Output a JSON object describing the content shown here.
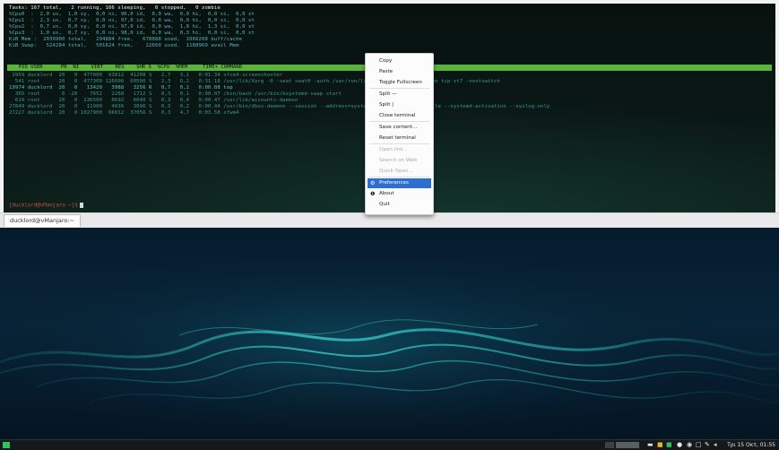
{
  "htop": {
    "summary": [
      "Tasks: 167 total,   2 running, 166 sleeping,   0 stopped,   0 zombie",
      "%Cpu0  :  2,0 us,  1,0 sy,  0,0 ni, 96,0 id,  0,0 wa,  0,0 hi,  0,0 si,  0,0 st",
      "%Cpu1  :  2,3 us,  0,7 sy,  0,0 ni, 97,0 id,  0,0 wa,  0,0 hi,  0,0 si,  0,0 st",
      "%Cpu2  :  0,7 us,  0,0 sy,  0,0 ni, 97,0 id,  0,0 wa,  1,0 hi,  1,3 si,  0,0 st",
      "%Cpu3  :  1,0 us,  0,7 sy,  0,0 ni, 98,0 id,  0,0 wa,  0,3 hi,  0,0 si,  0,0 st",
      "KiB Mem :  2039900 total,   294884 free,   678888 used,  1066208 buff/cache",
      "KiB Swap:   524284 total,   501624 free,    22660 used.  1188960 avail Mem"
    ],
    "header": "  PID USER      PR  NI    VIRT    RES    SHR S  %CPU  %MEM     TIME+ COMMAND",
    "rows": [
      " 2959 ducklord  20   0  477000  63012  41208 S   2,7   3,1   0:01.34 xfce4-screenshooter",
      "  541 root      20   0  477300 126096  60500 S   2,3   6,2   0:31.18 /usr/lib/Xorg -0 -seat seat0 -auth /var/run/lightdm/root/:0 -nolisten tcp vt7 -novtswitch",
      "19974 ducklord  20   0   13420   3988   3256 R   0,7   0,2   0:00.08 top",
      "  365 root       0 -20    7652   2268   1712 S   0,3   0,1   0:00.07 /bin/bash /usr/bin/ksystemd-swap start",
      "  619 root      20   0  236500   8692   6040 S   0,3   0,4   0:00.47 /usr/lib/accounts-daemon",
      "27849 ducklord  20   0   11900   4036   3096 S   0,3   0,2   0:00.44 /usr/bin/dbus-daemon --session --address=systemd: --nofork --nopidfile --systemd-activation --syslog-only",
      "27227 ducklord  20   0 1027900  66012  37056 S   0,3   4,7   0:03.58 xfwm4"
    ],
    "prompt": "[ducklord@vManjaro ~]$"
  },
  "tab": {
    "title": "ducklord@vManjaro:~"
  },
  "context_menu": {
    "items": [
      {
        "label": "Copy",
        "disabled": false
      },
      {
        "label": "Paste",
        "disabled": false
      },
      {
        "label": "Toggle Fullscreen",
        "disabled": false
      },
      {
        "label": "Split —",
        "disabled": false
      },
      {
        "label": "Split |",
        "disabled": false
      },
      {
        "label": "Close terminal",
        "disabled": false
      },
      {
        "label": "Save content...",
        "disabled": false
      },
      {
        "label": "Reset terminal",
        "disabled": false
      },
      {
        "label": "Open link...",
        "disabled": true
      },
      {
        "label": "Search on Web",
        "disabled": true
      },
      {
        "label": "Quick Open...",
        "disabled": true
      },
      {
        "label": "Preferences",
        "disabled": false,
        "active": true,
        "icon": "gear-icon"
      },
      {
        "label": "About",
        "disabled": false,
        "icon": "info-icon"
      },
      {
        "label": "Quit",
        "disabled": false
      }
    ]
  },
  "taskbar": {
    "clock": "Τρι 15 Οκτ, 01:55",
    "tray_icons": [
      "terminal-icon",
      "folder-icon",
      "green-app-icon",
      "network-icon",
      "shield-icon",
      "clipboard-icon",
      "pen-icon",
      "volume-icon"
    ]
  },
  "colors": {
    "accent": "#2d6fd0",
    "htop_header": "#5ab33a",
    "start_button": "#35bf5c"
  }
}
